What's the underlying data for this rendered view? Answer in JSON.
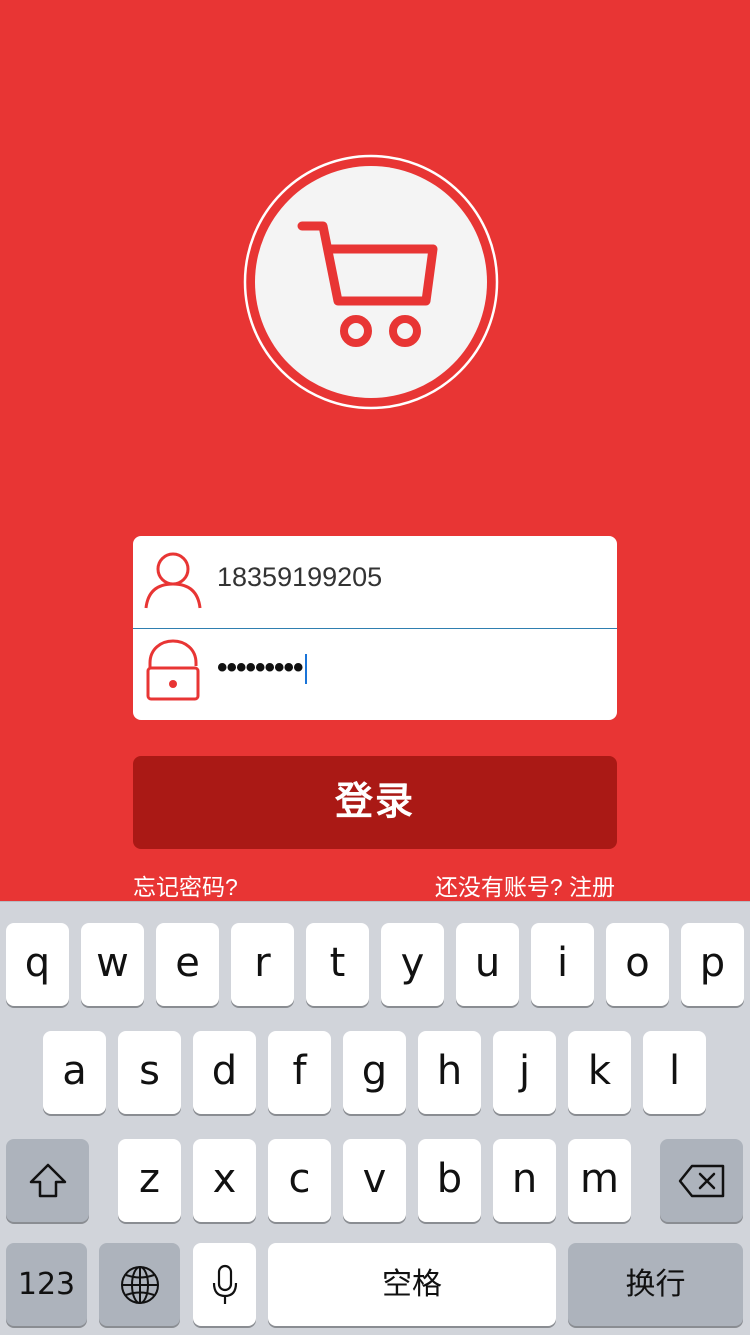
{
  "colors": {
    "brand": "#E83534",
    "button": "#AA1915",
    "keyboard_bg": "#D1D4DA"
  },
  "logo": {
    "icon": "shopping-cart-icon"
  },
  "form": {
    "username_value": "18359199205",
    "password_value": "•••••••••",
    "username_icon": "user-icon",
    "password_icon": "lock-icon"
  },
  "login_button": "登录",
  "links": {
    "forgot": "忘记密码?",
    "no_account": "还没有账号? ",
    "register": "注册"
  },
  "keyboard": {
    "row1": [
      "q",
      "w",
      "e",
      "r",
      "t",
      "y",
      "u",
      "i",
      "o",
      "p"
    ],
    "row2": [
      "a",
      "s",
      "d",
      "f",
      "g",
      "h",
      "j",
      "k",
      "l"
    ],
    "row3": [
      "z",
      "x",
      "c",
      "v",
      "b",
      "n",
      "m"
    ],
    "numbers_key": "123",
    "space_key": "空格",
    "return_key": "换行",
    "icons": [
      "shift-icon",
      "backspace-icon",
      "globe-icon",
      "microphone-icon"
    ]
  }
}
